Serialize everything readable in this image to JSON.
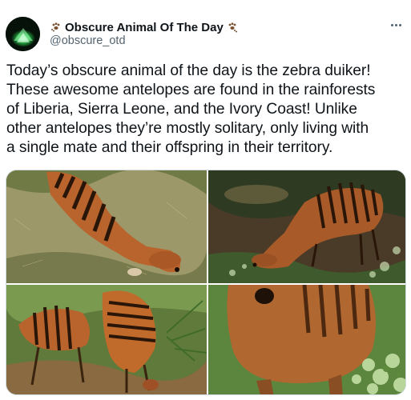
{
  "account": {
    "display_name": "Obscure Animal Of The Day",
    "handle": "@obscure_otd",
    "avatar_icon": "glowing-plant-icon",
    "badge_icon": "paw-prints-icon"
  },
  "tweet": {
    "text": "Today’s obscure animal of the day is the zebra duiker!\nThese awesome antelopes are found in the rainforests\nof Liberia, Sierra Leone, and the Ivory Coast! Unlike\nother antelopes they’re mostly solitary, only living with\na single mate and their offspring in their territory."
  },
  "media": {
    "photos": [
      {
        "name": "zebra-duiker-grazing-on-dry-grass"
      },
      {
        "name": "zebra-duiker-grazing-in-shade"
      },
      {
        "name": "zebra-duiker-pair-standing"
      },
      {
        "name": "zebra-duiker-closeup-foliage"
      }
    ]
  },
  "colors": {
    "text": "#0f1419",
    "secondary": "#536471",
    "duiker_coat": "#b8642c",
    "duiker_stripe": "#2a1608"
  },
  "more_menu_icon": "more-options-icon"
}
